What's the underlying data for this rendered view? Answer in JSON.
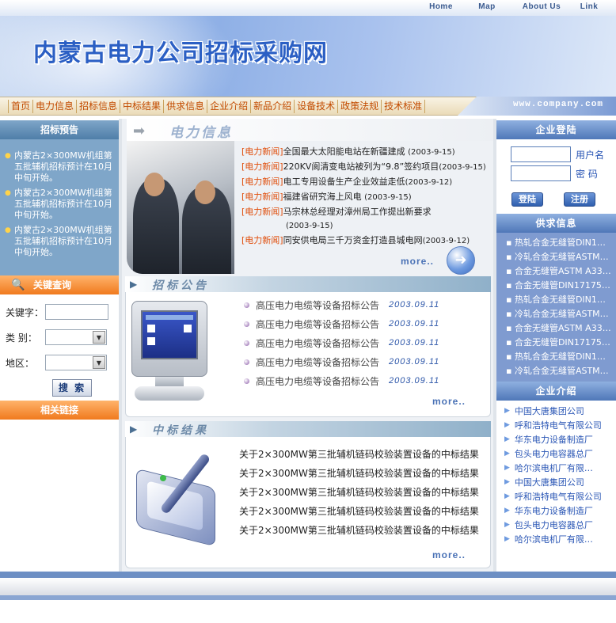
{
  "top_links": [
    "Home",
    "Map",
    "About Us",
    "Link"
  ],
  "site_title": "内蒙古电力公司招标采购网",
  "nav": {
    "items": [
      "首页",
      "电力信息",
      "招标信息",
      "中标结果",
      "供求信息",
      "企业介绍",
      "新品介绍",
      "设备技术",
      "政策法规",
      "技术标准"
    ],
    "domain": "www.company.com"
  },
  "left": {
    "tender_preview_title": "招标预告",
    "tender_items": [
      "内蒙古2×300MW机组第五批辅机招标预计在10月中旬开始。",
      "内蒙古2×300MW机组第五批辅机招标预计在10月中旬开始。",
      "内蒙古2×300MW机组第五批辅机招标预计在10月中旬开始。"
    ],
    "keyword_search_title": "关键查询",
    "keyword_label": "关键字：",
    "category_label": "类 别：",
    "region_label": "地区：",
    "search_button": "搜 索",
    "related_links_title": "相关链接"
  },
  "power_info": {
    "title": "电力信息",
    "news": [
      {
        "tag": "[电力新闻]",
        "text": "全国最大太阳能电站在新疆建成",
        "date": "(2003-9-15)"
      },
      {
        "tag": "[电力新闻]",
        "text": "220KV阆清变电站被列为“9.8”签约项目",
        "date": "(2003-9-15)"
      },
      {
        "tag": "[电力新闻]",
        "text": "电工专用设备生产企业效益走低",
        "date": "(2003-9-12)"
      },
      {
        "tag": "[电力新闻]",
        "text": "福建省研究海上风电",
        "date": "(2003-9-15)"
      },
      {
        "tag": "[电力新闻]",
        "text": "马宗林总经理对漳州局工作提出新要求",
        "date": "(2003-9-15)"
      },
      {
        "tag": "[电力新闻]",
        "text": "同安供电局三千万资金打造县城电网",
        "date": "(2003-9-12)"
      }
    ],
    "more": "more.."
  },
  "tender_notice": {
    "title": "招标公告",
    "items": [
      {
        "text": "高压电力电缆等设备招标公告",
        "date": "2003.09.11"
      },
      {
        "text": "高压电力电缆等设备招标公告",
        "date": "2003.09.11"
      },
      {
        "text": "高压电力电缆等设备招标公告",
        "date": "2003.09.11"
      },
      {
        "text": "高压电力电缆等设备招标公告",
        "date": "2003.09.11"
      },
      {
        "text": "高压电力电缆等设备招标公告",
        "date": "2003.09.11"
      }
    ],
    "more": "more.."
  },
  "winning_results": {
    "title": "中标结果",
    "items": [
      "关于2×300MW第三批辅机链码校验装置设备的中标结果",
      "关于2×300MW第三批辅机链码校验装置设备的中标结果",
      "关于2×300MW第三批辅机链码校验装置设备的中标结果",
      "关于2×300MW第三批辅机链码校验装置设备的中标结果",
      "关于2×300MW第三批辅机链码校验装置设备的中标结果"
    ],
    "more": "more.."
  },
  "right": {
    "login_title": "企业登陆",
    "username_label": "用户名",
    "password_label": "密  码",
    "login_button": "登陆",
    "register_button": "注册",
    "supply_title": "供求信息",
    "supply_items": [
      "热轧合金无缝管DIN1…",
      "冷轧合金无缝管ASTM…",
      "合金无缝管ASTM A33…",
      "合金无缝管DIN17175…",
      "热轧合金无缝管DIN1…",
      "冷轧合金无缝管ASTM…",
      "合金无缝管ASTM A33…",
      "合金无缝管DIN17175…",
      "热轧合金无缝管DIN1…",
      "冷轧合金无缝管ASTM…"
    ],
    "company_title": "企业介绍",
    "companies": [
      "中国大唐集团公司",
      "呼和浩特电气有限公司",
      "华东电力设备制造厂",
      "包头电力电容器总厂",
      "哈尔滨电机厂有限…",
      "中国大唐集团公司",
      "呼和浩特电气有限公司",
      "华东电力设备制造厂",
      "包头电力电容器总厂",
      "哈尔滨电机厂有限…"
    ]
  }
}
